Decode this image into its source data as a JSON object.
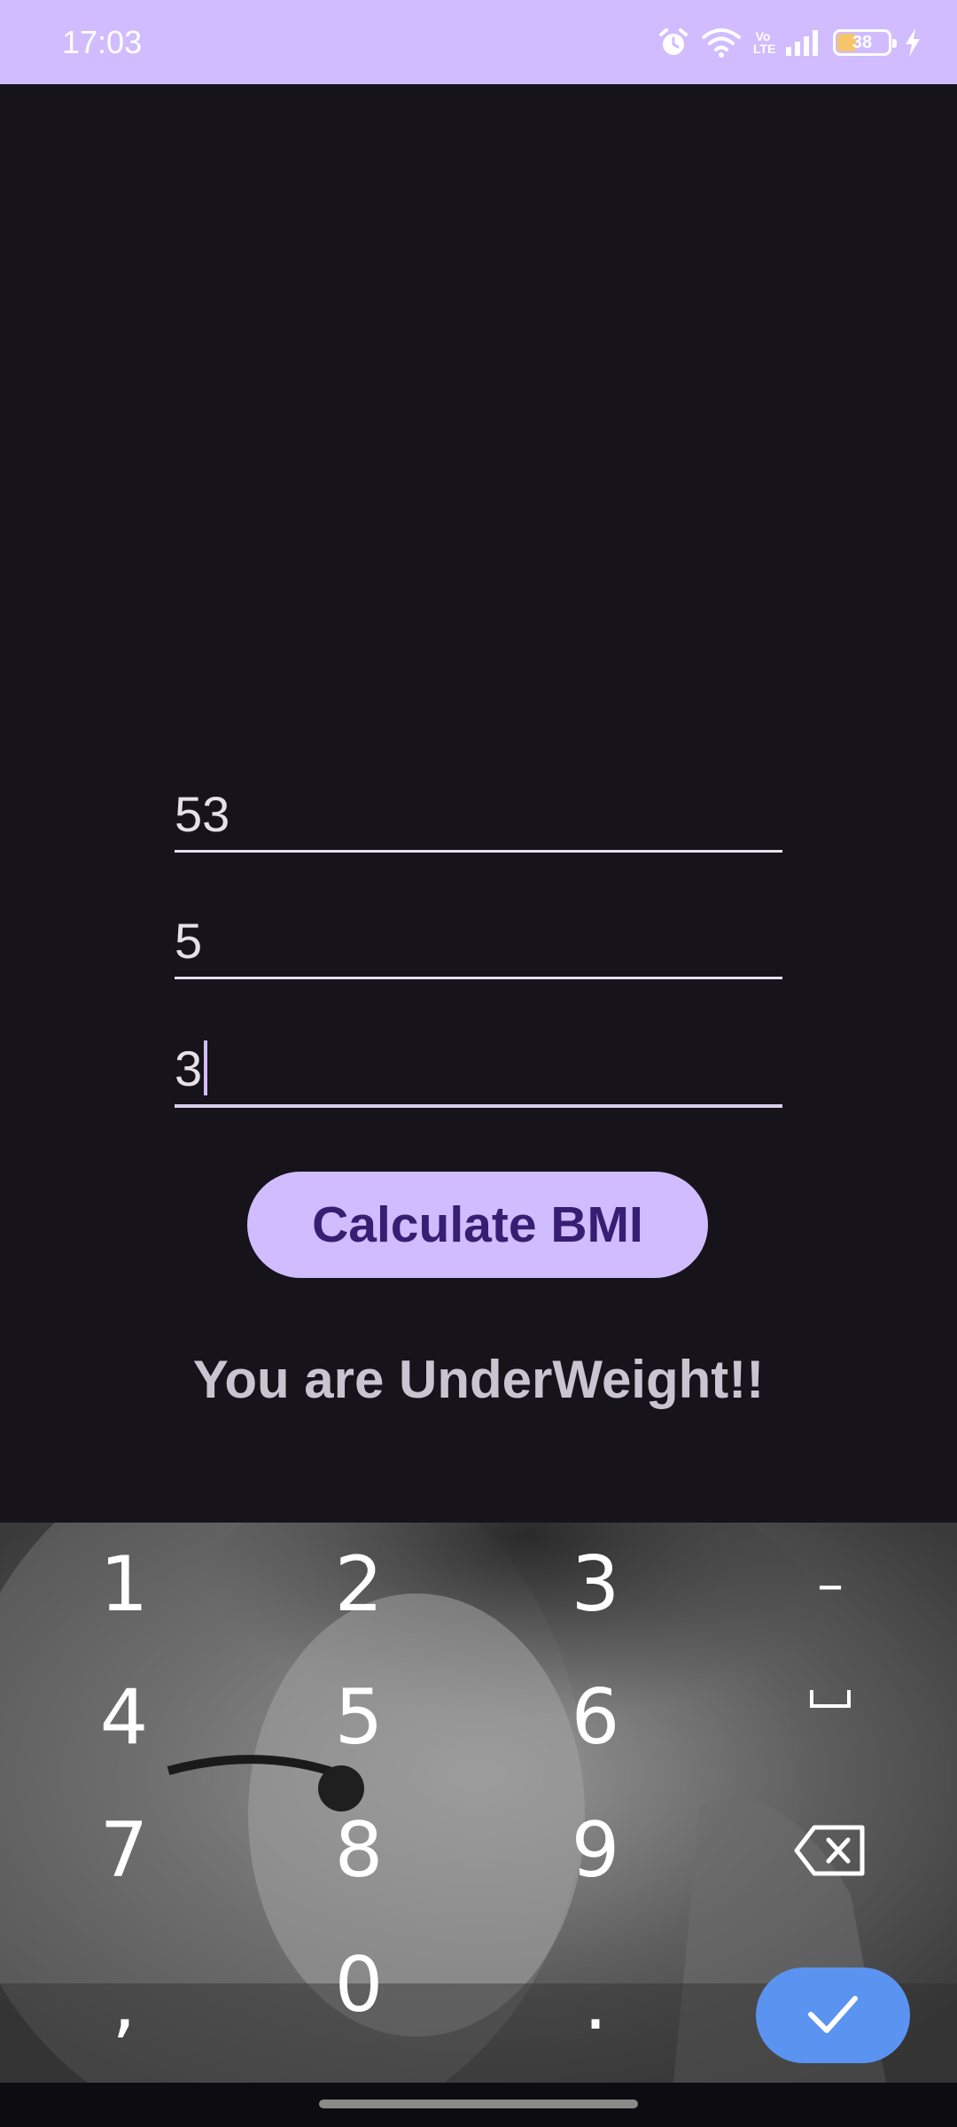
{
  "status_bar": {
    "time": "17:03",
    "icons": [
      "alarm-icon",
      "wifi-icon",
      "volte-icon",
      "signal-icon",
      "battery-icon",
      "charging-icon"
    ],
    "volte_label": "Vo LTE",
    "battery_level": "38",
    "battery_percent": 38
  },
  "form": {
    "fields": [
      {
        "value": "53"
      },
      {
        "value": "5"
      },
      {
        "value": "3"
      }
    ],
    "calculate_button": "Calculate BMI",
    "result": "You are UnderWeight!!"
  },
  "keyboard": {
    "rows": [
      [
        "1",
        "2",
        "3",
        "–"
      ],
      [
        "4",
        "5",
        "6",
        "space-icon"
      ],
      [
        "7",
        "8",
        "9",
        "backspace-icon"
      ],
      [
        ",",
        "0",
        ".",
        "check-icon"
      ]
    ]
  },
  "colors": {
    "accent": "#d0bcfe",
    "background": "#16131b",
    "button_text": "#381e72",
    "enter_key": "#5b93f0"
  }
}
